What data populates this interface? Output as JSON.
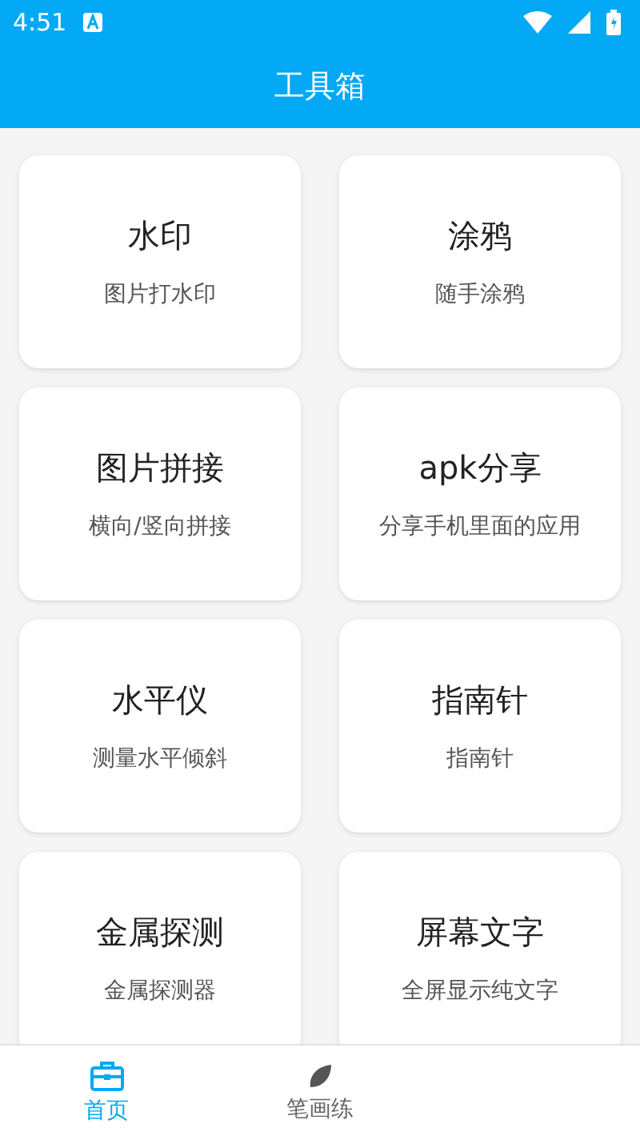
{
  "status_bar": {
    "time": "4:51"
  },
  "title": "工具箱",
  "tools": [
    {
      "name": "水印",
      "desc": "图片打水印"
    },
    {
      "name": "涂鸦",
      "desc": "随手涂鸦"
    },
    {
      "name": "图片拼接",
      "desc": "横向/竖向拼接"
    },
    {
      "name": "apk分享",
      "desc": "分享手机里面的应用"
    },
    {
      "name": "水平仪",
      "desc": "测量水平倾斜"
    },
    {
      "name": "指南针",
      "desc": "指南针"
    },
    {
      "name": "金属探测",
      "desc": "金属探测器"
    },
    {
      "name": "屏幕文字",
      "desc": "全屏显示纯文字"
    }
  ],
  "nav": [
    {
      "label": "首页",
      "kind": "toolbox",
      "selected": true
    },
    {
      "label": "笔画练",
      "kind": "leaf",
      "selected": false
    }
  ]
}
